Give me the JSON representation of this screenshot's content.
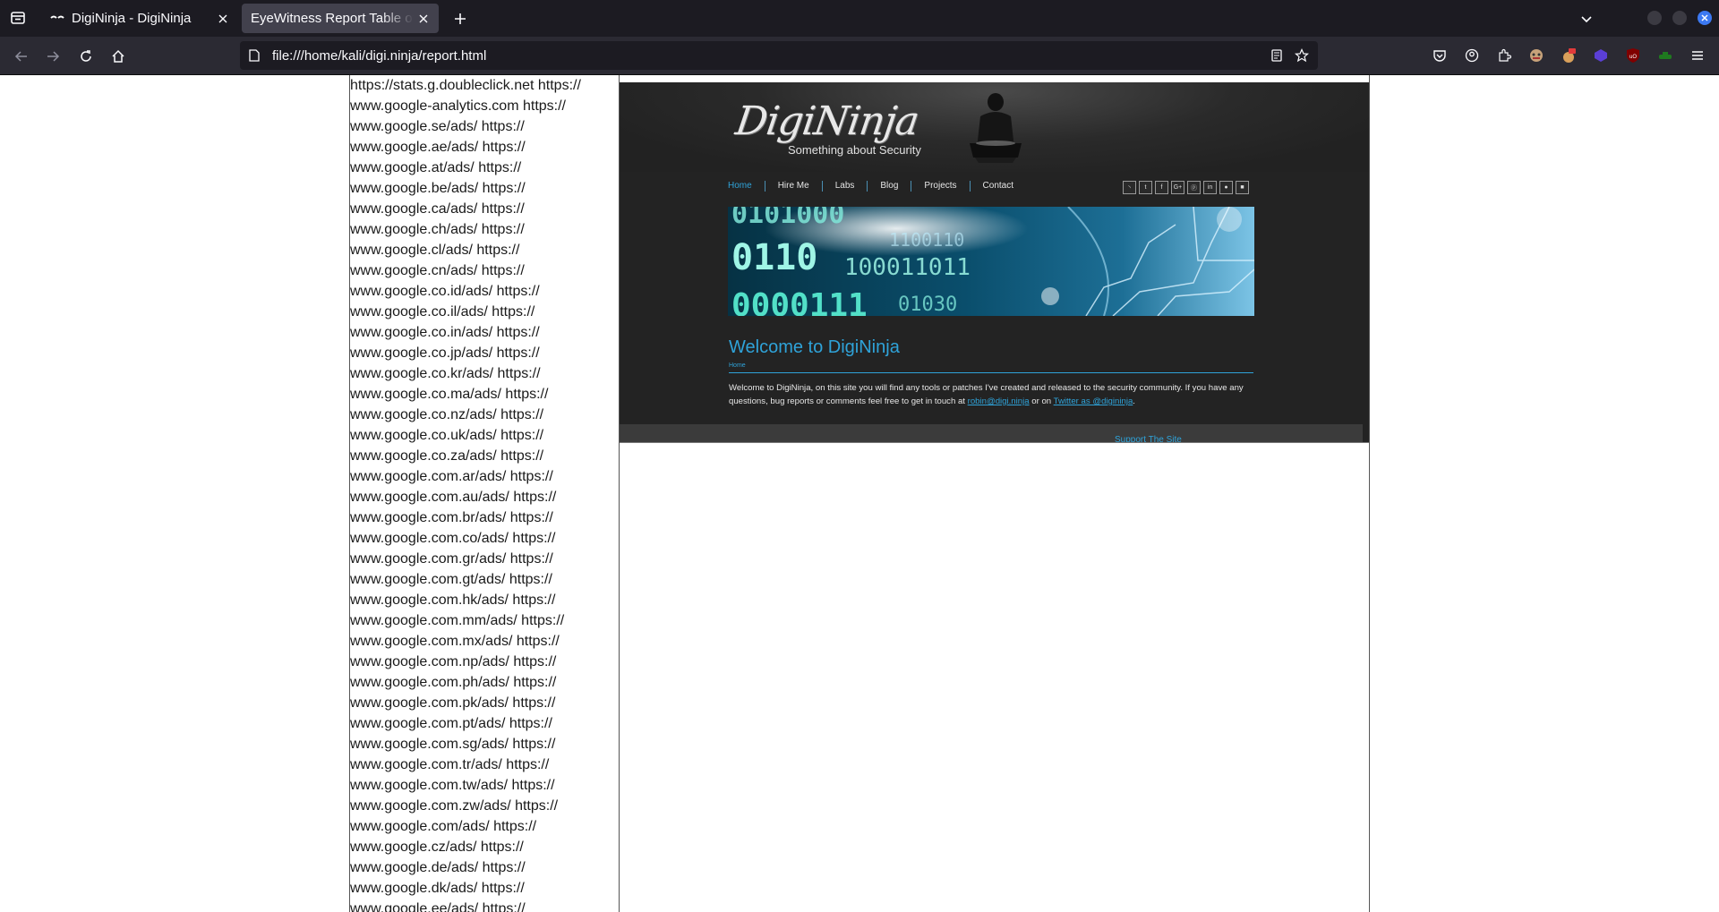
{
  "browser": {
    "tabs": [
      {
        "title": "DigiNinja - DigiNinja",
        "active": false
      },
      {
        "title": "EyeWitness Report Table of Contents",
        "active": true
      }
    ],
    "address": "file:///home/kali/digi.ninja/report.html",
    "accent_color": "#3c79f2"
  },
  "report": {
    "url_lines": [
      "https://stats.g.doubleclick.net https://",
      "www.google-analytics.com https://",
      "www.google.se/ads/ https://",
      "www.google.ae/ads/ https://",
      "www.google.at/ads/ https://",
      "www.google.be/ads/ https://",
      "www.google.ca/ads/ https://",
      "www.google.ch/ads/ https://",
      "www.google.cl/ads/ https://",
      "www.google.cn/ads/ https://",
      "www.google.co.id/ads/ https://",
      "www.google.co.il/ads/ https://",
      "www.google.co.in/ads/ https://",
      "www.google.co.jp/ads/ https://",
      "www.google.co.kr/ads/ https://",
      "www.google.co.ma/ads/ https://",
      "www.google.co.nz/ads/ https://",
      "www.google.co.uk/ads/ https://",
      "www.google.co.za/ads/ https://",
      "www.google.com.ar/ads/ https://",
      "www.google.com.au/ads/ https://",
      "www.google.com.br/ads/ https://",
      "www.google.com.co/ads/ https://",
      "www.google.com.gr/ads/ https://",
      "www.google.com.gt/ads/ https://",
      "www.google.com.hk/ads/ https://",
      "www.google.com.mm/ads/ https://",
      "www.google.com.mx/ads/ https://",
      "www.google.com.np/ads/ https://",
      "www.google.com.ph/ads/ https://",
      "www.google.com.pk/ads/ https://",
      "www.google.com.pt/ads/ https://",
      "www.google.com.sg/ads/ https://",
      "www.google.com.tr/ads/ https://",
      "www.google.com.tw/ads/ https://",
      "www.google.com.zw/ads/ https://",
      "www.google.com/ads/ https://",
      "www.google.cz/ads/ https://",
      "www.google.de/ads/ https://",
      "www.google.dk/ads/ https://",
      "www.google.ee/ads/ https://"
    ]
  },
  "site": {
    "logo_text": "DigiNinja",
    "tagline": "Something about Security",
    "nav": [
      "Home",
      "Hire Me",
      "Labs",
      "Blog",
      "Projects",
      "Contact"
    ],
    "social_icons": [
      "rss-icon",
      "twitter-icon",
      "facebook-icon",
      "google-plus-icon",
      "pinterest-icon",
      "linkedin-icon",
      "reddit-icon",
      "mastodon-icon"
    ],
    "social_glyphs": [
      "◝",
      "t",
      "f",
      "G+",
      "ⓟ",
      "in",
      "●",
      "■"
    ],
    "heading": "Welcome to DigiNinja",
    "breadcrumb": "Home",
    "intro_before": "Welcome to DigiNinja, on this site you will find any tools or patches I've created and released to the security community. If you have any questions, bug reports or comments feel free to get in touch at ",
    "email": "robin@digi.ninja",
    "intro_middle": " or on ",
    "twitter": "Twitter as @digininja",
    "intro_after": ".",
    "footer_link": "Support The Site",
    "accent_color": "#2fa3d9"
  }
}
